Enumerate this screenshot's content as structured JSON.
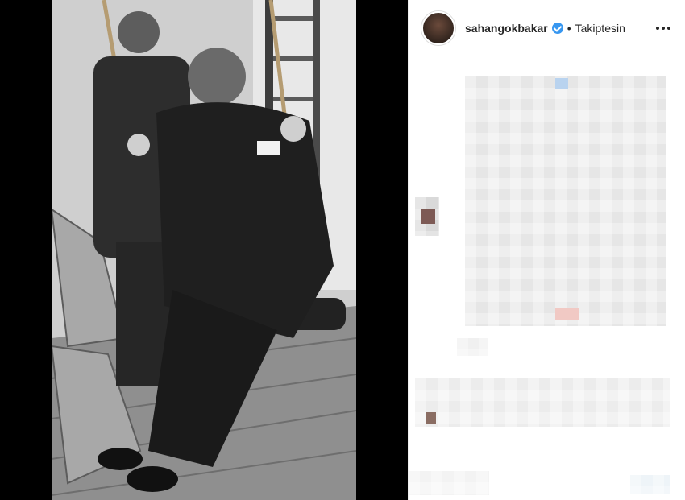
{
  "post": {
    "username": "sahangokbakar",
    "follow_status": "Takiptesin",
    "separator": "•"
  },
  "icons": {
    "verified": "verified-badge-icon",
    "more": "more-options-icon"
  },
  "colors": {
    "verified_badge": "#3897f0",
    "panel_background": "#ffffff",
    "media_background": "#000000",
    "text": "#262626"
  }
}
